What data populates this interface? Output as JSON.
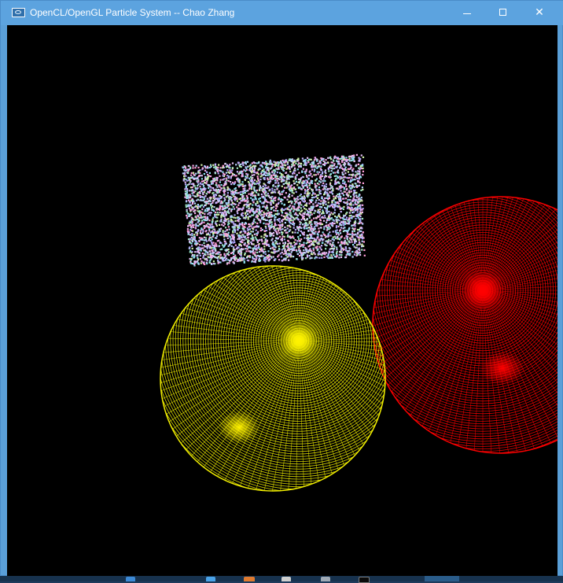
{
  "window": {
    "title": "OpenCL/OpenGL Particle System -- Chao Zhang",
    "app_icon": "opengl-app-icon",
    "controls": {
      "minimize_icon": "minimize-icon",
      "maximize_icon": "maximize-icon",
      "close_icon": "close-icon",
      "close_label": "✕"
    }
  },
  "scene": {
    "background": "#000000",
    "particle_block": {
      "colors": [
        "#a9a0f5",
        "#8fe0f0",
        "#f2a7e6",
        "#c7b4ff",
        "#9ee6c2",
        "#e6c0f7",
        "#b8d6ff",
        "#ff9fd8",
        "#d1f0a8"
      ]
    },
    "spheres": [
      {
        "name": "yellow-sphere",
        "color": "#f2ef00"
      },
      {
        "name": "red-sphere",
        "color": "#ff0000"
      }
    ]
  },
  "taskbar": {
    "background": "#17324e",
    "items": [
      "start-icon",
      "app-icon-blue",
      "app-icon-orange",
      "app-icon-gray",
      "app-icon-white",
      "app-icon-black"
    ]
  }
}
